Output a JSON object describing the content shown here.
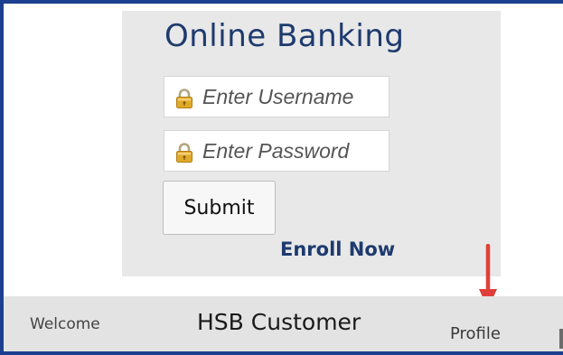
{
  "login": {
    "title": "Online Banking",
    "username_placeholder": "Enter Username",
    "password_placeholder": "Enter Password",
    "submit_label": "Submit",
    "enroll_label": "Enroll Now",
    "lock_icon": "padlock-icon"
  },
  "nav": {
    "welcome_label": "Welcome",
    "customer_name": "HSB Customer",
    "profile_label": "Profile"
  },
  "annotation": {
    "arrow_color": "#e0403a",
    "target": "Profile"
  },
  "colors": {
    "brand_blue": "#1c3f8f",
    "title_navy": "#1e3a6e",
    "panel_gray": "#e8e8e8",
    "nav_gray": "#e3e3e3"
  }
}
